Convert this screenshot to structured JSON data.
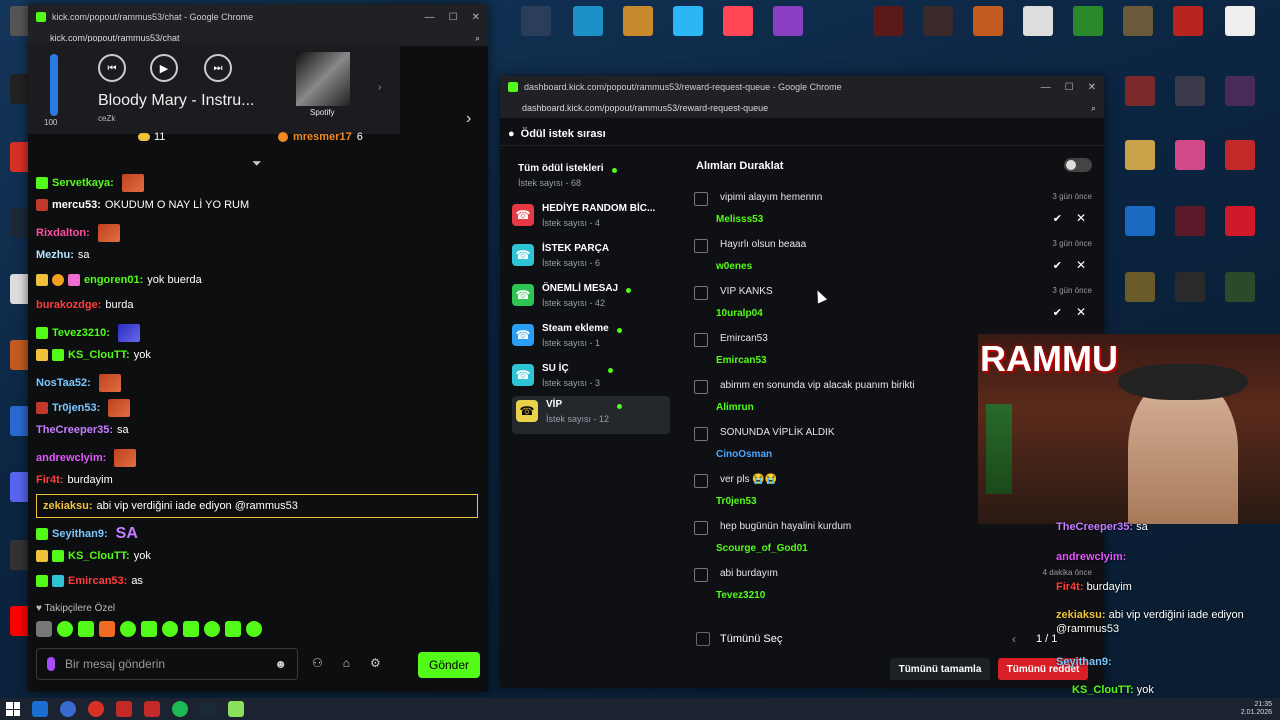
{
  "chat_window": {
    "title": "kick.com/popout/rammus53/chat - Google Chrome",
    "url": "kick.com/popout/rammus53/chat",
    "media": {
      "track": "Bloody Mary - Instru...",
      "artist": "ceZk",
      "volume": "100",
      "source": "Spotify"
    },
    "pinned": {
      "count": "11",
      "top_user": "mresmer17",
      "top_count": "6"
    },
    "messages": [
      {
        "user": "Servetkaya:",
        "color": "#53fc18",
        "text": ""
      },
      {
        "user": "mercu53:",
        "color": "#ffffff",
        "text": "OKUDUM O NAY Lİ YO RUM"
      },
      {
        "user": "Rixdalton:",
        "color": "#ff4fa0",
        "text": ""
      },
      {
        "user": "Mezhu:",
        "color": "#b7e6ff",
        "text": "sa"
      },
      {
        "user": "engoren01:",
        "color": "#53fc18",
        "text": "yok buerda"
      },
      {
        "user": "burakozdge:",
        "color": "#ff3c3c",
        "text": "burda"
      },
      {
        "user": "Tevez3210:",
        "color": "#53fc18",
        "text": ""
      },
      {
        "user": "KS_ClouTT:",
        "color": "#53fc18",
        "text": "yok"
      },
      {
        "user": "NosTaa52:",
        "color": "#7ac8ff",
        "text": ""
      },
      {
        "user": "Tr0jen53:",
        "color": "#7ac8ff",
        "text": ""
      },
      {
        "user": "TheCreeper35:",
        "color": "#c77dff",
        "text": "sa"
      },
      {
        "user": "andrewclyim:",
        "color": "#e056fd",
        "text": ""
      },
      {
        "user": "Fir4t:",
        "color": "#ff3c3c",
        "text": "burdayim"
      },
      {
        "user": "zekiaksu:",
        "color": "#f0c23b",
        "text": "abi vip verdiğini iade ediyon @rammus53"
      },
      {
        "user": "Seyithan9:",
        "color": "#7ac8ff",
        "text": ""
      },
      {
        "user": "KS_ClouTT:",
        "color": "#53fc18",
        "text": "yok"
      },
      {
        "user": "Emircan53:",
        "color": "#ff3c3c",
        "text": "as"
      }
    ],
    "follower_label": "Takipçilere Özel",
    "input_placeholder": "Bir mesaj gönderin",
    "send_label": "Gönder"
  },
  "dashboard_window": {
    "title": "dashboard.kick.com/popout/rammus53/reward-request-queue - Google Chrome",
    "url": "dashboard.kick.com/popout/rammus53/reward-request-queue",
    "header": "Ödül istek sırası",
    "pause_label": "Alımları Duraklat",
    "rewards": [
      {
        "name": "Tüm ödül istekleri",
        "sub": "İstek sayısı - 68",
        "color": "",
        "dot": true
      },
      {
        "name": "HEDİYE RANDOM BİC...",
        "sub": "İstek sayısı - 4",
        "color": "#e63946",
        "dot": false
      },
      {
        "name": "İSTEK PARÇA",
        "sub": "İstek sayısı - 6",
        "color": "#2ec4d6",
        "dot": false
      },
      {
        "name": "ÖNEMLİ MESAJ",
        "sub": "İstek sayısı - 42",
        "color": "#2dc653",
        "dot": true
      },
      {
        "name": "Steam ekleme",
        "sub": "İstek sayısı - 1",
        "color": "#2a9df4",
        "dot": true
      },
      {
        "name": "SU İÇ",
        "sub": "İstek sayısı - 3",
        "color": "#2ec4d6",
        "dot": true
      },
      {
        "name": "VİP",
        "sub": "İstek sayısı - 12",
        "color": "#e9d14a",
        "dot": true
      }
    ],
    "requests": [
      {
        "text": "vipimi alayım hemennn",
        "user": "Melisss53",
        "time": "3 gün önce",
        "actions": true
      },
      {
        "text": "Hayırlı olsun beaaa",
        "user": "w0enes",
        "time": "3 gün önce",
        "actions": true
      },
      {
        "text": "VIP KANKS",
        "user": "10uralp04",
        "time": "3 gün önce",
        "actions": true
      },
      {
        "text": "Emircan53",
        "user": "Emircan53",
        "time": "",
        "actions": false
      },
      {
        "text": "abimm en sonunda vip alacak puanım birikti",
        "user": "Alimrun",
        "time": "",
        "actions": false
      },
      {
        "text": "SONUNDA VİPLİK ALDIK",
        "user": "CinoOsman",
        "time": "",
        "actions": false
      },
      {
        "text": "ver pls 😭😭",
        "user": "Tr0jen53",
        "time": "",
        "actions": false
      },
      {
        "text": "hep bugünün hayalini kurdum",
        "user": "Scourge_of_God01",
        "time": "",
        "actions": false
      },
      {
        "text": "abi burdayım",
        "user": "Tevez3210",
        "time": "4 dakika önce",
        "actions": false
      }
    ],
    "select_all": "Tümünü Seç",
    "pagination": "1 / 1",
    "complete_all": "Tümünü tamamla",
    "reject_all": "Tümünü reddet"
  },
  "overlay": {
    "banner": "RAMMU",
    "lines": [
      {
        "user": "TheCreeper35:",
        "text": "sa"
      },
      {
        "user": "andrewclyim:",
        "text": ""
      },
      {
        "user": "Fir4t:",
        "text": "burdayim"
      },
      {
        "user": "zekiaksu:",
        "text": "abi vip verdiğini iade ediyon @rammus53"
      },
      {
        "user": "Seyithan9:",
        "text": ""
      },
      {
        "user": "KS_ClouTT:",
        "text": "yok"
      }
    ]
  },
  "taskbar": {
    "clock": "21:35",
    "date": "2.01.2026"
  }
}
